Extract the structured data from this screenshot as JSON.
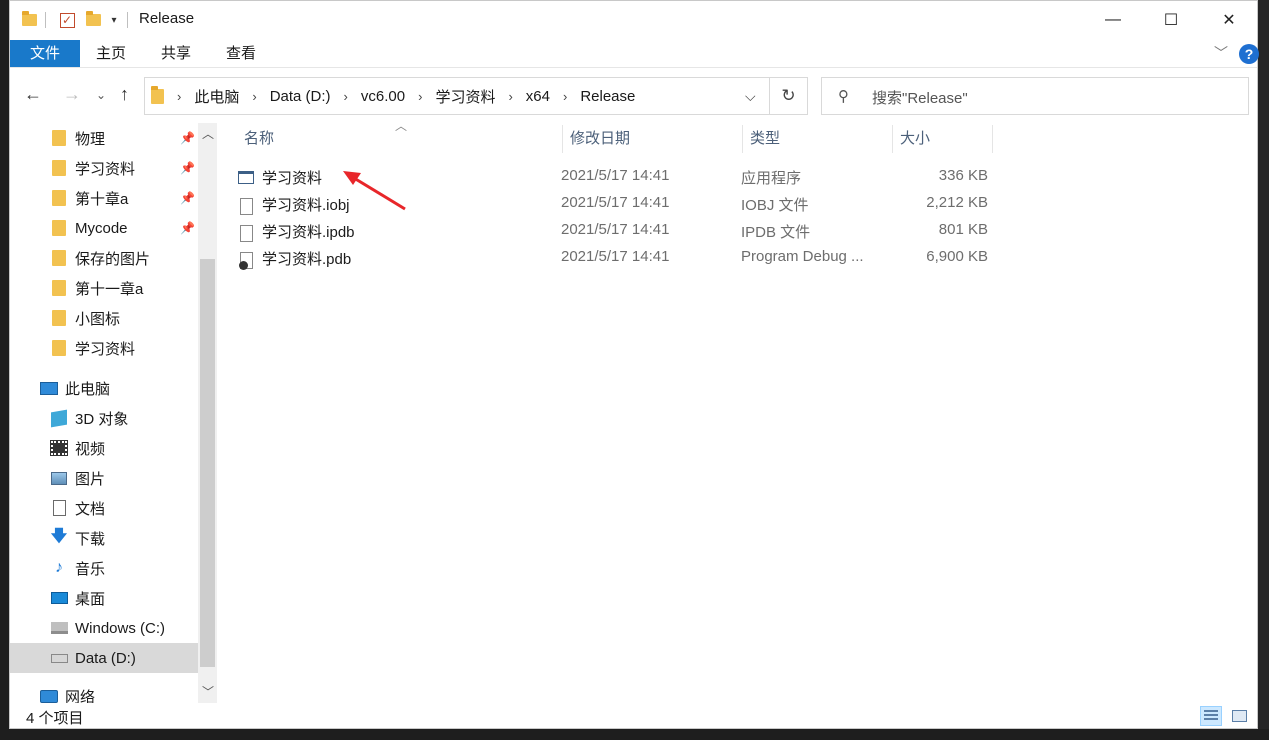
{
  "window": {
    "title": "Release",
    "controls": {
      "minimize": "—",
      "maximize": "☐",
      "close": "✕"
    }
  },
  "ribbon": {
    "file_tab": "文件",
    "tabs": [
      "主页",
      "共享",
      "查看"
    ],
    "help": "?"
  },
  "address": {
    "crumbs": [
      "此电脑",
      "Data (D:)",
      "vc6.00",
      "学习资料",
      "x64",
      "Release"
    ],
    "search_placeholder": "搜索\"Release\""
  },
  "nav": {
    "quick_access": [
      {
        "label": "物理",
        "pinned": true
      },
      {
        "label": "学习资料",
        "pinned": true
      },
      {
        "label": "第十章a",
        "pinned": true
      },
      {
        "label": "Mycode",
        "pinned": true
      },
      {
        "label": "保存的图片",
        "pinned": false
      },
      {
        "label": "第十一章a",
        "pinned": false
      },
      {
        "label": "小图标",
        "pinned": false
      },
      {
        "label": "学习资料",
        "pinned": false
      }
    ],
    "this_pc": "此电脑",
    "pc_items": [
      "3D 对象",
      "视频",
      "图片",
      "文档",
      "下载",
      "音乐",
      "桌面",
      "Windows (C:)",
      "Data (D:)"
    ],
    "network": "网络"
  },
  "columns": {
    "name": "名称",
    "date": "修改日期",
    "type": "类型",
    "size": "大小"
  },
  "files": [
    {
      "name": "学习资料",
      "date": "2021/5/17 14:41",
      "type": "应用程序",
      "size": "336 KB",
      "icon": "exe-icon"
    },
    {
      "name": "学习资料.iobj",
      "date": "2021/5/17 14:41",
      "type": "IOBJ 文件",
      "size": "2,212 KB",
      "icon": "file-icon"
    },
    {
      "name": "学习资料.ipdb",
      "date": "2021/5/17 14:41",
      "type": "IPDB 文件",
      "size": "801 KB",
      "icon": "file-icon"
    },
    {
      "name": "学习资料.pdb",
      "date": "2021/5/17 14:41",
      "type": "Program Debug ...",
      "size": "6,900 KB",
      "icon": "pdb-icon"
    }
  ],
  "status": {
    "count": "4 个项目"
  },
  "colors": {
    "accent": "#1979ca",
    "arrow": "#e8262a",
    "selected_nav": "#d9d9d9"
  }
}
